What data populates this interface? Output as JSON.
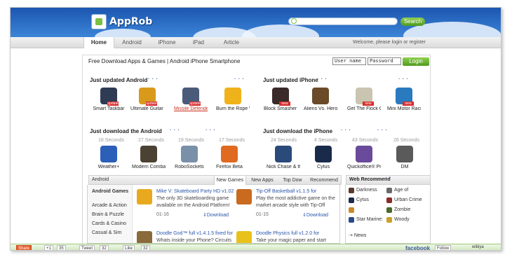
{
  "header": {
    "logo_text": "AppRob",
    "search_button": "Search"
  },
  "nav": {
    "items": [
      "Home",
      "Android",
      "iPhone",
      "iPad",
      "Article"
    ],
    "welcome": "Welcome",
    "please": "please",
    "login": "login",
    "or": "or",
    "register": "register"
  },
  "main": {
    "title": "Free Download Apps & Games | Android iPhone Smartphone",
    "username_placeholder": "User name",
    "password_placeholder": "Password",
    "login_button": "Login"
  },
  "sections": {
    "updated_android": {
      "title": "Just updated Android",
      "apps": [
        {
          "name": "Smart Taskbar",
          "tag": "update",
          "color": "#2f3b55"
        },
        {
          "name": "Ultimate Guitar Tab",
          "tag": "update",
          "color": "#d99a1b"
        },
        {
          "name": "Missile Defender",
          "tag": "update",
          "color": "#4a5b7a"
        },
        {
          "name": "Burn the Rope W",
          "tag": "",
          "color": "#f0b21a"
        }
      ]
    },
    "updated_iphone": {
      "title": "Just updated iPhone",
      "apps": [
        {
          "name": "Block Smasher - A",
          "tag": "new",
          "color": "#3a2a2a"
        },
        {
          "name": "Aliens Vs. Heroes",
          "tag": "",
          "color": "#6b4a2a"
        },
        {
          "name": "Get The Flock Out",
          "tag": "new",
          "color": "#c9c5b0"
        },
        {
          "name": "Mini Motor Racing",
          "tag": "new",
          "color": "#2a7ac0"
        }
      ]
    },
    "download_android": {
      "title": "Just download the Android",
      "apps": [
        {
          "name": "Weather+",
          "seconds": "18 Seconds",
          "color": "#2b5fb8"
        },
        {
          "name": "Modern Combat 3",
          "seconds": "27 Seconds",
          "color": "#4c4233"
        },
        {
          "name": "RoboSockets",
          "seconds": "19 Seconds",
          "color": "#7a8fa8"
        },
        {
          "name": "Firefox Beta",
          "seconds": "17 Seconds",
          "color": "#e06a1f"
        }
      ]
    },
    "download_iphone": {
      "title": "Just download the iPhone",
      "apps": [
        {
          "name": "Nick Chase & th",
          "seconds": "24 Seconds",
          "color": "#2a4a7a"
        },
        {
          "name": "Cytus",
          "seconds": "4 Seconds",
          "color": "#1a2a4a"
        },
        {
          "name": "Quickoffice® Pro",
          "seconds": "43 Seconds",
          "color": "#6a4a9a"
        },
        {
          "name": "DM",
          "seconds": "26 Seconds",
          "color": "#5a5a5a"
        }
      ]
    }
  },
  "bottom": {
    "panel_label": "Android",
    "tabs": [
      "New Games",
      "New Apps",
      "Top Dow",
      "Recommend"
    ],
    "categories": [
      "Android Games",
      "Arcade & Action",
      "Brain & Puzzle",
      "Cards & Casino",
      "Casual & Sim"
    ],
    "feed": [
      {
        "title": "Mike V: Skateboard Party HD v1.02",
        "desc": "The only 3D skateboarding game available on the Android Platform!",
        "date": "01-16",
        "download": "Download",
        "color": "#e8a91f"
      },
      {
        "title": "Tip-Off Basketball v1.1.5 for",
        "desc": "Play the most addictive game on the market arcade style with Tip-Off",
        "date": "01-15",
        "download": "Download",
        "color": "#c96a1f"
      },
      {
        "title": "Doodle God™ full v1.4.1.5 fixed for",
        "desc": "Whats inside your Phone? Circuits",
        "color": "#8a6a3a"
      },
      {
        "title": "Doodle Physics full v1.2.0 for",
        "desc": "Take your magic paper and start",
        "color": "#e8c21a"
      }
    ],
    "web_recommend": {
      "title": "Web Recommend",
      "items": [
        {
          "name": "Darkness",
          "color": "#5a3a2a"
        },
        {
          "name": "Age of",
          "color": "#6a6a6a"
        },
        {
          "name": "Cytus",
          "color": "#1a2a4a"
        },
        {
          "name": "Urban Crime",
          "color": "#8a2a2a"
        },
        {
          "name": "",
          "color": "#c98a2a"
        },
        {
          "name": "Zombie",
          "color": "#4a6a2a"
        },
        {
          "name": "Star Marine:",
          "color": "#2a4a8a"
        },
        {
          "name": "Woody",
          "color": "#c9a02a"
        }
      ],
      "news": "News"
    }
  },
  "share_bar": {
    "share": "Share",
    "count1": "35",
    "tweet": "Tweet",
    "count2": "32",
    "like": "Like",
    "count3": "32",
    "facebook": "facebook",
    "follow": "Follow",
    "powered": "wibiya"
  }
}
